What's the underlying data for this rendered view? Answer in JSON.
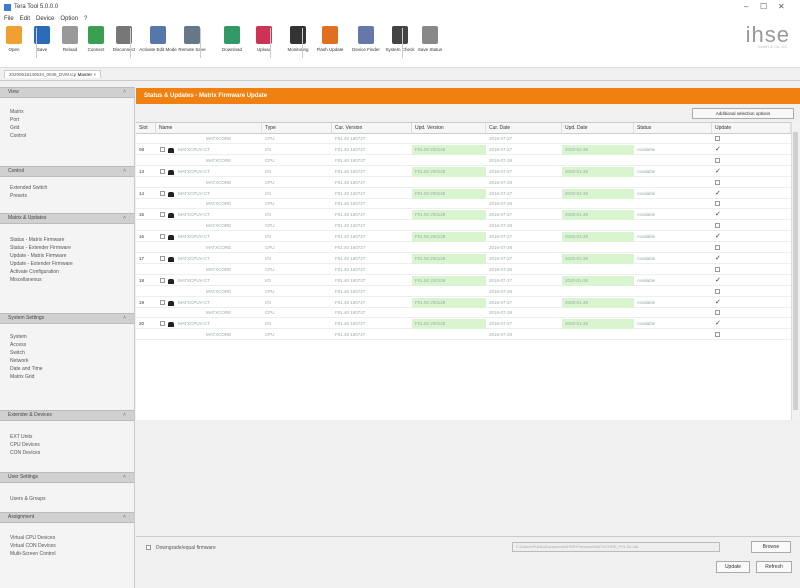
{
  "window": {
    "title": "Tera Tool 5.0.0.0",
    "minimize": "–",
    "maximize": "☐",
    "close": "✕"
  },
  "menu": [
    "File",
    "Edit",
    "Device",
    "Option",
    "?"
  ],
  "toolbar": [
    {
      "label": "Open",
      "icon": "folder-icon",
      "color": "#f0a030"
    },
    {
      "label": "Save",
      "icon": "save-icon",
      "color": "#2a6ab8"
    },
    {
      "label": "Reload",
      "icon": "reload-icon",
      "color": "#999999"
    },
    {
      "label": "Connect",
      "icon": "connect-icon",
      "color": "#3aa050"
    },
    {
      "label": "Disconnect",
      "icon": "disconnect-icon",
      "color": "#777777"
    },
    {
      "label": "Activate Edit Mode",
      "icon": "edit-mode-icon",
      "color": "#5577aa"
    },
    {
      "label": "Remote Save",
      "icon": "remote-save-icon",
      "color": "#667788"
    },
    {
      "label": "Download",
      "icon": "download-icon",
      "color": "#339966"
    },
    {
      "label": "Upload",
      "icon": "upload-icon",
      "color": "#cc3355"
    },
    {
      "label": "Monitoring",
      "icon": "monitor-icon",
      "color": "#333333"
    },
    {
      "label": "Flash Update",
      "icon": "flash-icon",
      "color": "#e07020"
    },
    {
      "label": "Device Finder",
      "icon": "finder-icon",
      "color": "#6677aa"
    },
    {
      "label": "System Check",
      "icon": "system-check-icon",
      "color": "#444444"
    },
    {
      "label": "Save Status",
      "icon": "save-status-icon",
      "color": "#888888"
    }
  ],
  "logo": {
    "text": "ihse",
    "sub": "GmbH & Co. KG"
  },
  "file_tab": {
    "name": "20200618140534_0048_DVM.tcp",
    "mode": "Master",
    "close": "×"
  },
  "sidebar": {
    "sections": [
      {
        "title": "View",
        "items": [
          "Matrix",
          "Port",
          "Grid",
          "Control"
        ]
      },
      {
        "title": "Control",
        "items": [
          "Extended Switch",
          "Presets"
        ]
      },
      {
        "title": "Matrix & Updates",
        "items": [
          "Status - Matrix Firmware",
          "Status - Extender Firmware",
          "Update - Matrix Firmware",
          "Update - Extender Firmware",
          "Activate Configuration",
          "Miscellaneous"
        ]
      },
      {
        "title": "System Settings",
        "items": [
          "System",
          "Access",
          "Switch",
          "Network",
          "Date and Time",
          "Matrix Grid"
        ]
      },
      {
        "title": "Extender & Devices",
        "items": [
          "EXT Units",
          "CPU Devices",
          "CON Devices"
        ]
      },
      {
        "title": "User Settings",
        "items": [
          "Users & Groups"
        ]
      },
      {
        "title": "Assignment",
        "items": [
          "Virtual CPU Devices",
          "Virtual CON Devices",
          "Multi-Screen Control"
        ]
      }
    ],
    "chevron": "˄"
  },
  "header": {
    "title": "Status & Updates - Matrix Firmware Update"
  },
  "buttons": {
    "additional": "Additional selection options",
    "browse": "Browse",
    "update": "Update",
    "refresh": "Refresh"
  },
  "columns": [
    "Slot",
    "Name",
    "Type",
    "Cur. Version",
    "Upd. Version",
    "Cur. Date",
    "Upd. Date",
    "Status",
    "Update"
  ],
  "rows": [
    {
      "slot": "",
      "name": "MATXCORE",
      "type": "CPU",
      "cur": "F01.40 160727",
      "upd": "",
      "cdate": "2016-07-27",
      "udate": "",
      "status": "",
      "parent": false,
      "green": false,
      "checked": false
    },
    {
      "slot": "08",
      "name": "MATXCPUV-CT",
      "type": "I/O",
      "cur": "F01.40 160727",
      "upd": "F01.50 200128",
      "cdate": "2016-07-27",
      "udate": "2020-01-28",
      "status": "Available",
      "parent": true,
      "green": true,
      "checked": true
    },
    {
      "slot": "",
      "name": "MATXCORE",
      "type": "CPU",
      "cur": "F01.40 160727",
      "upd": "",
      "cdate": "2016-07-28",
      "udate": "",
      "status": "",
      "parent": false,
      "green": false,
      "checked": false
    },
    {
      "slot": "13",
      "name": "MATXCPUV-CT",
      "type": "I/O",
      "cur": "F01.40 160727",
      "upd": "F01.50 200128",
      "cdate": "2016-07-27",
      "udate": "2020-01-28",
      "status": "Available",
      "parent": true,
      "green": true,
      "checked": true
    },
    {
      "slot": "",
      "name": "MATXCORE",
      "type": "CPU",
      "cur": "F01.40 160727",
      "upd": "",
      "cdate": "2016-07-28",
      "udate": "",
      "status": "",
      "parent": false,
      "green": false,
      "checked": false
    },
    {
      "slot": "14",
      "name": "MATXCPUV-CT",
      "type": "I/O",
      "cur": "F01.40 160727",
      "upd": "F01.50 200128",
      "cdate": "2016-07-27",
      "udate": "2020-01-28",
      "status": "Available",
      "parent": true,
      "green": true,
      "checked": true
    },
    {
      "slot": "",
      "name": "MATXCORE",
      "type": "CPU",
      "cur": "F01.40 160727",
      "upd": "",
      "cdate": "2016-07-28",
      "udate": "",
      "status": "",
      "parent": false,
      "green": false,
      "checked": false
    },
    {
      "slot": "15",
      "name": "MATXCPUV-CT",
      "type": "I/O",
      "cur": "F01.40 160727",
      "upd": "F01.50 200128",
      "cdate": "2016-07-27",
      "udate": "2020-01-28",
      "status": "Available",
      "parent": true,
      "green": true,
      "checked": true
    },
    {
      "slot": "",
      "name": "MATXCORE",
      "type": "CPU",
      "cur": "F01.40 160727",
      "upd": "",
      "cdate": "2016-07-28",
      "udate": "",
      "status": "",
      "parent": false,
      "green": false,
      "checked": false
    },
    {
      "slot": "16",
      "name": "MATXCPUV-CT",
      "type": "I/O",
      "cur": "F01.40 160727",
      "upd": "F01.50 200128",
      "cdate": "2016-07-27",
      "udate": "2020-01-28",
      "status": "Available",
      "parent": true,
      "green": true,
      "checked": true
    },
    {
      "slot": "",
      "name": "MATXCORE",
      "type": "CPU",
      "cur": "F01.40 160727",
      "upd": "",
      "cdate": "2016-07-28",
      "udate": "",
      "status": "",
      "parent": false,
      "green": false,
      "checked": false
    },
    {
      "slot": "17",
      "name": "MATXCPUV-CT",
      "type": "I/O",
      "cur": "F01.40 160727",
      "upd": "F01.50 200128",
      "cdate": "2016-07-27",
      "udate": "2020-01-28",
      "status": "Available",
      "parent": true,
      "green": true,
      "checked": true
    },
    {
      "slot": "",
      "name": "MATXCORE",
      "type": "CPU",
      "cur": "F01.40 160727",
      "upd": "",
      "cdate": "2016-07-28",
      "udate": "",
      "status": "",
      "parent": false,
      "green": false,
      "checked": false
    },
    {
      "slot": "18",
      "name": "MATXCPUV-CT",
      "type": "I/O",
      "cur": "F01.40 160727",
      "upd": "F01.50 200128",
      "cdate": "2016-07-27",
      "udate": "2020-01-28",
      "status": "Available",
      "parent": true,
      "green": true,
      "checked": true
    },
    {
      "slot": "",
      "name": "MATXCORE",
      "type": "CPU",
      "cur": "F01.40 160727",
      "upd": "",
      "cdate": "2016-07-28",
      "udate": "",
      "status": "",
      "parent": false,
      "green": false,
      "checked": false
    },
    {
      "slot": "19",
      "name": "MATXCPUV-CT",
      "type": "I/O",
      "cur": "F01.40 160727",
      "upd": "F01.50 200128",
      "cdate": "2016-07-27",
      "udate": "2020-01-28",
      "status": "Available",
      "parent": true,
      "green": true,
      "checked": true
    },
    {
      "slot": "",
      "name": "MATXCORE",
      "type": "CPU",
      "cur": "F01.40 160727",
      "upd": "",
      "cdate": "2016-07-28",
      "udate": "",
      "status": "",
      "parent": false,
      "green": false,
      "checked": false
    },
    {
      "slot": "20",
      "name": "MATXCPUV-CT",
      "type": "I/O",
      "cur": "F01.40 160727",
      "upd": "F01.50 200128",
      "cdate": "2016-07-27",
      "udate": "2020-01-28",
      "status": "Available",
      "parent": true,
      "green": true,
      "checked": true
    },
    {
      "slot": "",
      "name": "MATXCORE",
      "type": "CPU",
      "cur": "F01.40 160727",
      "upd": "",
      "cdate": "2016-07-28",
      "udate": "",
      "status": "",
      "parent": false,
      "green": false,
      "checked": false
    }
  ],
  "bottom": {
    "downgrade_label": "Downgrade/equal firmware",
    "firmware_path": "C:\\Users\\Public\\Documents\\IHSE\\Firmware\\MATXCORE_F01.50.dat"
  },
  "colors": {
    "accent": "#f08010",
    "update_green": "#d8f5d0"
  }
}
